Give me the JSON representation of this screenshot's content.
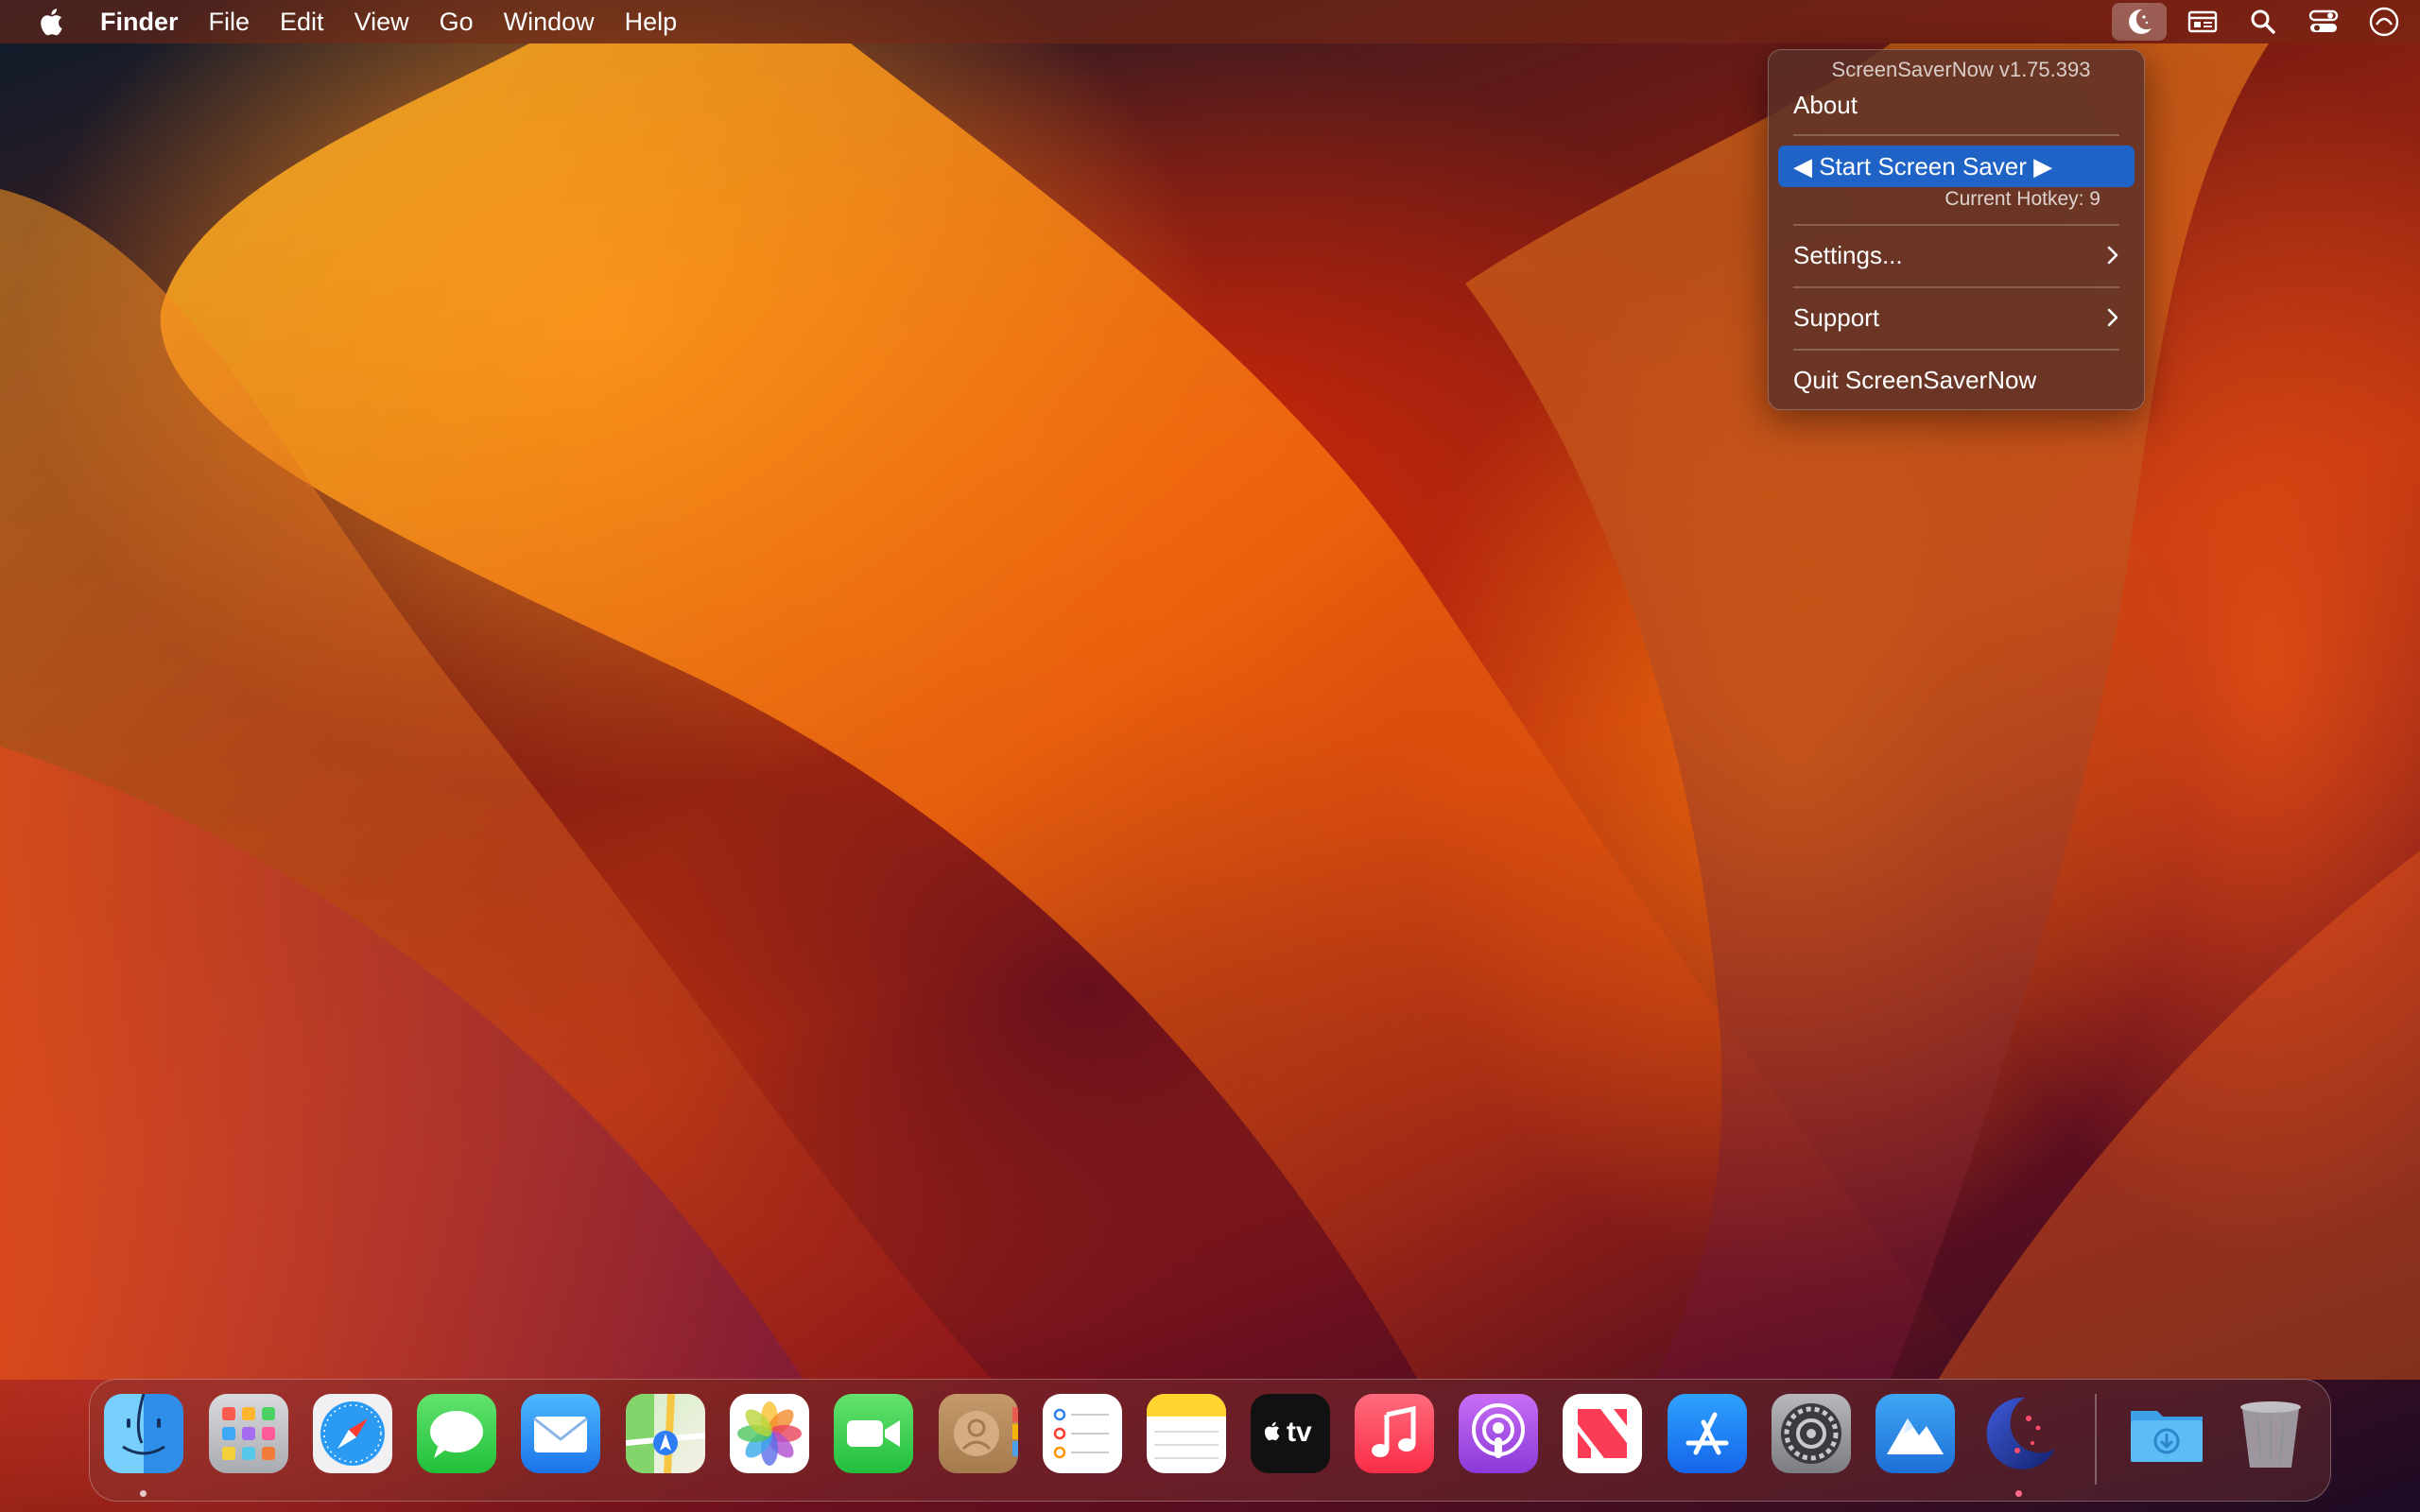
{
  "menubar": {
    "apple_icon": "apple-logo-icon",
    "app_name": "Finder",
    "menus": [
      "File",
      "Edit",
      "View",
      "Go",
      "Window",
      "Help"
    ],
    "status_icons": [
      "screensavernow-moon-icon",
      "input-display-icon",
      "spotlight-search-icon",
      "control-center-icon",
      "siri-icon"
    ]
  },
  "dropdown": {
    "version": "ScreenSaverNow v1.75.393",
    "about": "About",
    "start": "◀ Start Screen Saver ▶",
    "hotkey": "Current Hotkey: 9",
    "settings": "Settings...",
    "support": "Support",
    "quit": "Quit ScreenSaverNow",
    "highlight_color": "#1f63c6"
  },
  "dock": {
    "apps": [
      {
        "name": "Finder",
        "icon": "finder-icon",
        "running": true
      },
      {
        "name": "Launchpad",
        "icon": "launchpad-icon",
        "running": false
      },
      {
        "name": "Safari",
        "icon": "safari-icon",
        "running": false
      },
      {
        "name": "Messages",
        "icon": "messages-icon",
        "running": false
      },
      {
        "name": "Mail",
        "icon": "mail-icon",
        "running": false
      },
      {
        "name": "Maps",
        "icon": "maps-icon",
        "running": false
      },
      {
        "name": "Photos",
        "icon": "photos-icon",
        "running": false
      },
      {
        "name": "FaceTime",
        "icon": "facetime-icon",
        "running": false
      },
      {
        "name": "Contacts",
        "icon": "contacts-icon",
        "running": false
      },
      {
        "name": "Reminders",
        "icon": "reminders-icon",
        "running": false
      },
      {
        "name": "Notes",
        "icon": "notes-icon",
        "running": false
      },
      {
        "name": "TV",
        "icon": "apple-tv-icon",
        "running": false
      },
      {
        "name": "Music",
        "icon": "music-icon",
        "running": false
      },
      {
        "name": "Podcasts",
        "icon": "podcasts-icon",
        "running": false
      },
      {
        "name": "News",
        "icon": "news-icon",
        "running": false
      },
      {
        "name": "App Store",
        "icon": "app-store-icon",
        "running": false
      },
      {
        "name": "System Settings",
        "icon": "system-settings-icon",
        "running": false
      },
      {
        "name": "Monterey",
        "icon": "macos-installer-icon",
        "running": false
      },
      {
        "name": "ScreenSaverNow",
        "icon": "screensavernow-moon-icon",
        "running": true
      }
    ],
    "downloads": "downloads-folder-icon",
    "trash": "trash-icon",
    "tv_label": "tv"
  }
}
